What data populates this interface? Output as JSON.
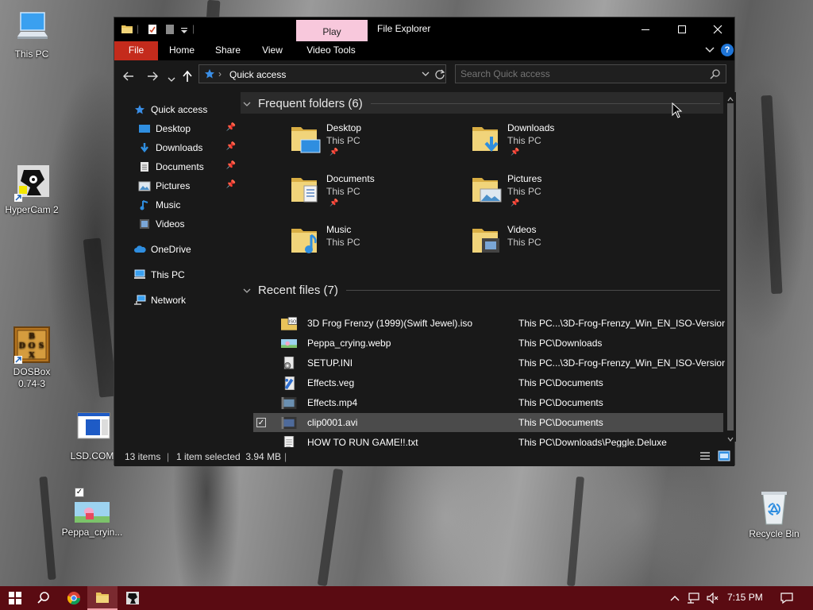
{
  "desktop": {
    "icons": [
      {
        "label": "This PC",
        "icon": "this-pc-icon"
      },
      {
        "label": "HyperCam 2",
        "icon": "hypercam-icon"
      },
      {
        "label": "DOSBox 0.74-3",
        "icon": "dosbox-icon"
      },
      {
        "label": "LSD.COM",
        "icon": "lsd-com-icon"
      },
      {
        "label": "Peppa_cryin...",
        "icon": "image-file-icon"
      },
      {
        "label": "Recycle Bin",
        "icon": "recycle-bin-icon"
      }
    ],
    "dosbox_letters": [
      "B",
      "D",
      "O",
      "S",
      "X"
    ]
  },
  "window": {
    "title": "File Explorer",
    "contextual_tab": "Play",
    "ribbon_tabs": {
      "file": "File",
      "home": "Home",
      "share": "Share",
      "view": "View",
      "video_tools": "Video Tools"
    },
    "help_glyph": "?",
    "address": {
      "path": "Quick access",
      "separator": "›"
    },
    "search": {
      "placeholder": "Search Quick access"
    }
  },
  "nav": {
    "items": [
      {
        "label": "Quick access",
        "icon": "star-icon"
      },
      {
        "label": "Desktop",
        "icon": "desktop-icon",
        "pinned": true
      },
      {
        "label": "Downloads",
        "icon": "download-icon",
        "pinned": true
      },
      {
        "label": "Documents",
        "icon": "document-icon",
        "pinned": true
      },
      {
        "label": "Pictures",
        "icon": "picture-icon",
        "pinned": true
      },
      {
        "label": "Music",
        "icon": "music-icon"
      },
      {
        "label": "Videos",
        "icon": "video-icon"
      },
      {
        "label": "OneDrive",
        "icon": "cloud-icon"
      },
      {
        "label": "This PC",
        "icon": "computer-icon"
      },
      {
        "label": "Network",
        "icon": "network-icon"
      }
    ]
  },
  "frequent": {
    "header": "Frequent folders (6)",
    "folders": [
      {
        "name": "Desktop",
        "location": "This PC",
        "pinned": true
      },
      {
        "name": "Downloads",
        "location": "This PC",
        "pinned": true
      },
      {
        "name": "Documents",
        "location": "This PC",
        "pinned": true
      },
      {
        "name": "Pictures",
        "location": "This PC",
        "pinned": true
      },
      {
        "name": "Music",
        "location": "This PC",
        "pinned": false
      },
      {
        "name": "Videos",
        "location": "This PC",
        "pinned": false
      }
    ]
  },
  "recent": {
    "header": "Recent files (7)",
    "files": [
      {
        "name": "3D Frog Frenzy (1999)(Swift Jewel).iso",
        "path": "This PC...\\3D-Frog-Frenzy_Win_EN_ISO-Version",
        "icon": "iso-file-icon"
      },
      {
        "name": "Peppa_crying.webp",
        "path": "This PC\\Downloads",
        "icon": "image-file-icon"
      },
      {
        "name": "SETUP.INI",
        "path": "This PC...\\3D-Frog-Frenzy_Win_EN_ISO-Version",
        "icon": "settings-file-icon"
      },
      {
        "name": "Effects.veg",
        "path": "This PC\\Documents",
        "icon": "veg-file-icon"
      },
      {
        "name": "Effects.mp4",
        "path": "This PC\\Documents",
        "icon": "video-file-icon"
      },
      {
        "name": "clip0001.avi",
        "path": "This PC\\Documents",
        "icon": "video-file-icon",
        "selected": true
      },
      {
        "name": "HOW TO RUN GAME!!.txt",
        "path": "This PC\\Downloads\\Peggle.Deluxe",
        "icon": "text-file-icon"
      }
    ]
  },
  "status": {
    "items": "13 items",
    "sep": "|",
    "selection": "1 item selected  3.94 MB",
    "sep2": "|"
  },
  "taskbar": {
    "time": "7:15 PM"
  },
  "colors": {
    "file_tab": "#c42b1c",
    "play_tab": "#f8c8dc",
    "taskbar": "#5a0b12",
    "folder": "#e8c35a",
    "accent": "#3a8ee6"
  }
}
